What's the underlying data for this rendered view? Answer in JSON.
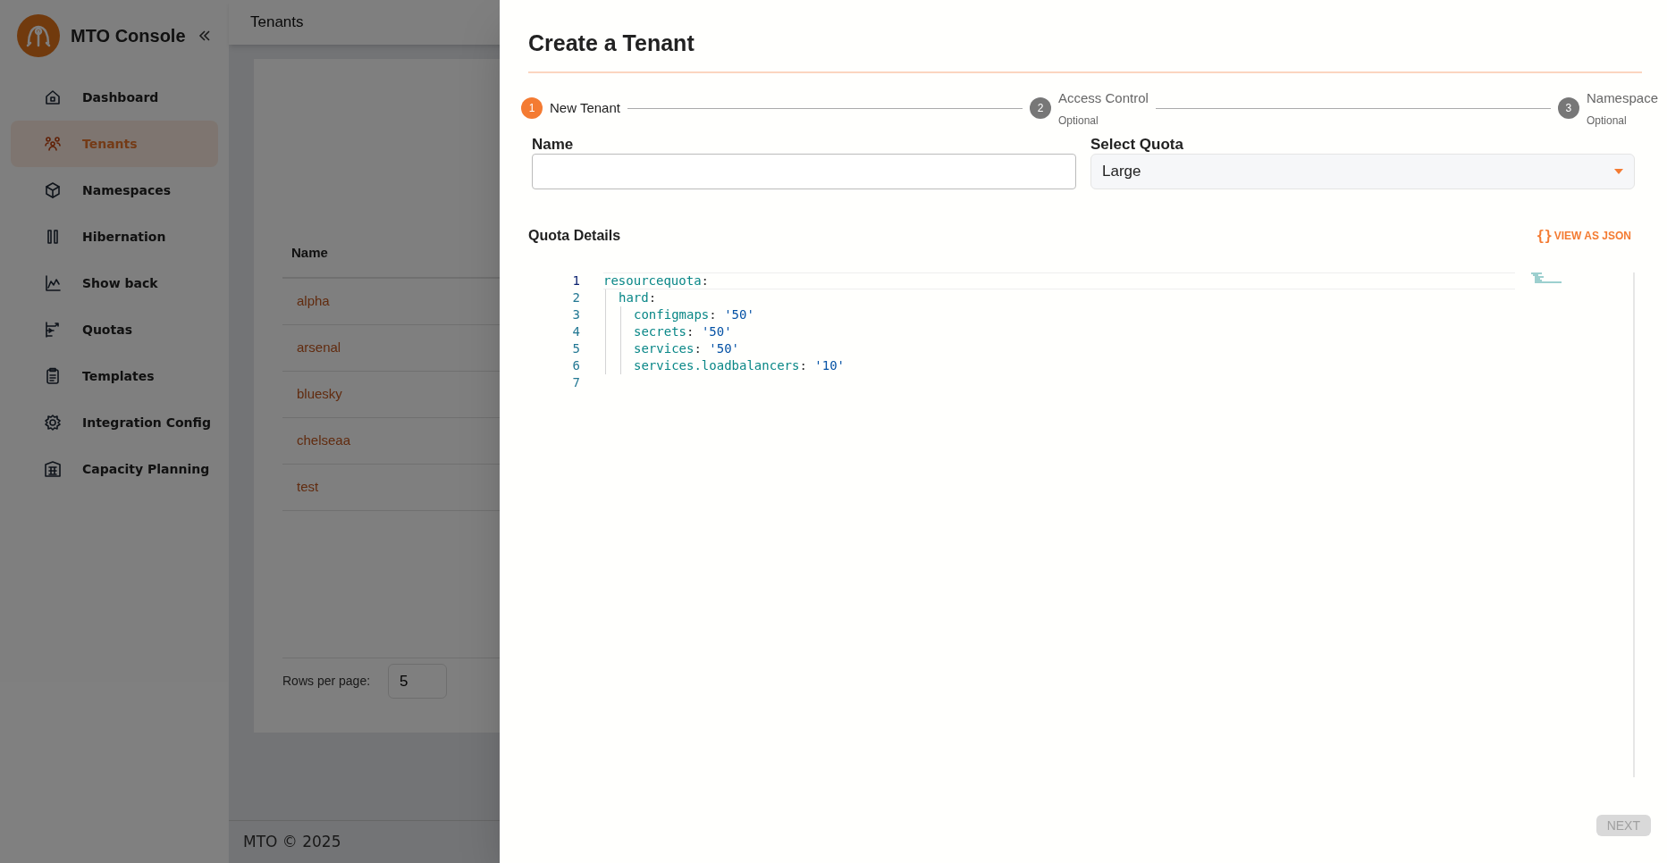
{
  "app": {
    "title": "MTO Console"
  },
  "sidebar": {
    "items": [
      {
        "label": "Dashboard",
        "kind": "home",
        "selected": false
      },
      {
        "label": "Tenants",
        "kind": "users",
        "selected": true
      },
      {
        "label": "Namespaces",
        "kind": "box",
        "selected": false
      },
      {
        "label": "Hibernation",
        "kind": "pause",
        "selected": false
      },
      {
        "label": "Show back",
        "kind": "chart",
        "selected": false
      },
      {
        "label": "Quotas",
        "kind": "quota",
        "selected": false
      },
      {
        "label": "Templates",
        "kind": "clipboard",
        "selected": false
      },
      {
        "label": "Integration Config",
        "kind": "gear",
        "selected": false
      },
      {
        "label": "Capacity Planning",
        "kind": "building",
        "selected": false
      }
    ]
  },
  "header": {
    "title": "Tenants"
  },
  "table": {
    "columns": [
      "Name"
    ],
    "rows": [
      {
        "name": "alpha"
      },
      {
        "name": "arsenal"
      },
      {
        "name": "bluesky"
      },
      {
        "name": "chelseaa"
      },
      {
        "name": "test"
      }
    ]
  },
  "pagination": {
    "label": "Rows per page:",
    "value": "5"
  },
  "footer": "MTO © 2025",
  "drawer": {
    "title": "Create a Tenant",
    "steps": [
      {
        "number": "1",
        "label": "New Tenant",
        "selected": true
      },
      {
        "number": "2",
        "label": "Access Control",
        "optional": "Optional",
        "selected": false
      },
      {
        "number": "3",
        "label": "Namespace",
        "optional": "Optional",
        "selected": false
      }
    ],
    "name_field": {
      "label": "Name"
    },
    "quota_field": {
      "label": "Select Quota",
      "value": "Large"
    },
    "quota_details": {
      "title": "Quota Details",
      "view_json": {
        "icon": "{}",
        "label": "VIEW AS JSON"
      }
    },
    "editor": {
      "line_numbers": [
        {
          "number": "1",
          "selected": true
        },
        {
          "number": "2",
          "selected": false
        },
        {
          "number": "3",
          "selected": false
        },
        {
          "number": "4",
          "selected": false
        },
        {
          "number": "5",
          "selected": false
        },
        {
          "number": "6",
          "selected": false
        },
        {
          "number": "7",
          "selected": false
        }
      ],
      "lines": [
        {
          "key": "resourcequota",
          "separator": ":",
          "children": [
            {
              "key": "hard",
              "separator": ":",
              "children": [
                {
                  "key": "configmaps",
                  "separator": ":",
                  "value": "'50'"
                },
                {
                  "key": "secrets",
                  "separator": ":",
                  "value": "'50'"
                },
                {
                  "key": "services",
                  "separator": ":",
                  "value": "'50'"
                },
                {
                  "key": "services.loadbalancers",
                  "separator": ":",
                  "value": "'10'"
                }
              ]
            }
          ]
        }
      ]
    },
    "next_button": {
      "label": "NEXT",
      "disabled": true
    }
  }
}
